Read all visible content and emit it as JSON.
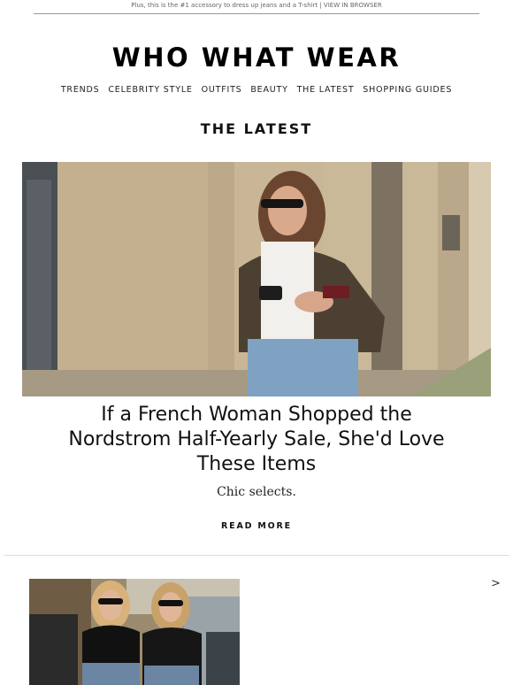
{
  "preheader": {
    "text": "Plus, this is the #1 accessory to dress up jeans and a T-shirt",
    "separator": "|",
    "view_in_browser": "VIEW IN BROWSER"
  },
  "brand": {
    "logo": "WHO WHAT WEAR"
  },
  "nav": {
    "items": [
      "TRENDS",
      "CELEBRITY STYLE",
      "OUTFITS",
      "BEAUTY",
      "THE LATEST",
      "SHOPPING GUIDES"
    ]
  },
  "section": {
    "title": "THE LATEST"
  },
  "article": {
    "headline": "If a French Woman Shopped the Nordstrom Half-Yearly Sale, She'd Love These Items",
    "dek": "Chic selects.",
    "cta": "READ MORE"
  },
  "next_article": {
    "arrow": ">"
  },
  "colors": {
    "text": "#111111",
    "rule": "#999999",
    "divider": "#dddddd"
  }
}
